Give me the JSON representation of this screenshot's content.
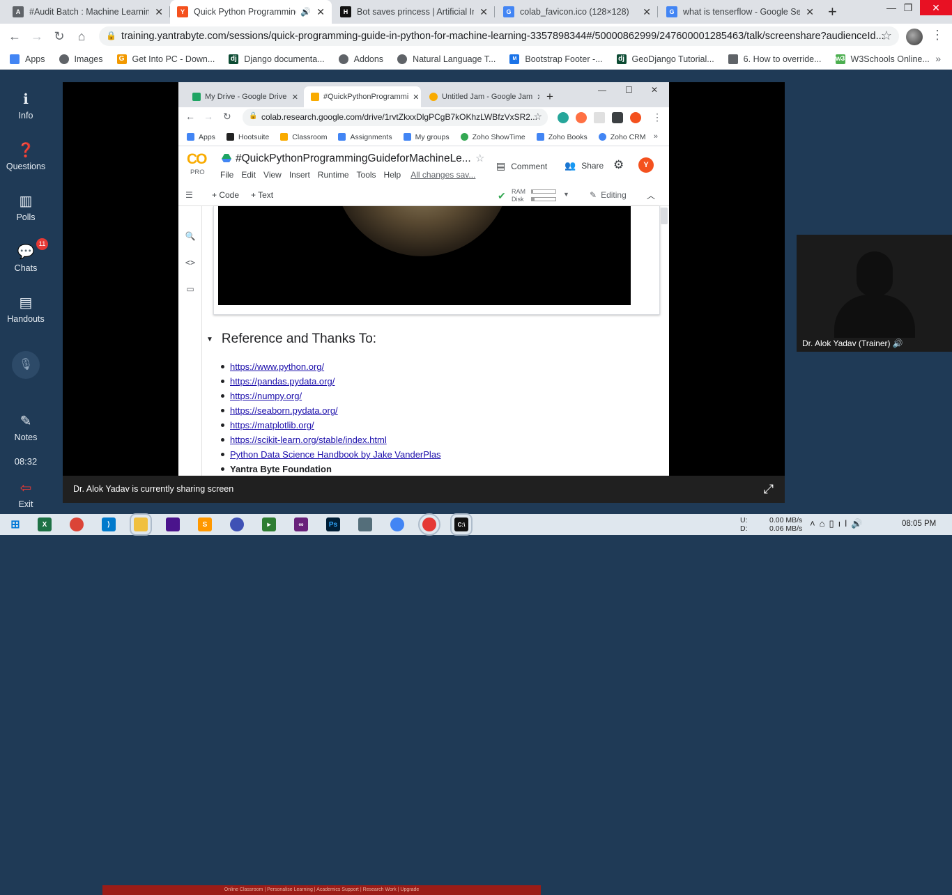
{
  "browser": {
    "tabs": [
      {
        "title": "#Audit Batch : Machine Learning",
        "color": "#5f6368",
        "letter": "A"
      },
      {
        "title": "Quick Python Programming",
        "color": "#f4511e",
        "letter": "Y"
      },
      {
        "title": "Bot saves princess | Artificial Inte",
        "color": "#111",
        "letter": "H"
      },
      {
        "title": "colab_favicon.ico (128×128)",
        "color": "#4285f4",
        "letter": "G"
      },
      {
        "title": "what is tenserflow - Google Sea",
        "color": "#4285f4",
        "letter": "G"
      }
    ],
    "url": "training.yantrabyte.com/sessions/quick-programming-guide-in-python-for-machine-learning-3357898344#/50000862999/247600001285463/talk/screenshare?audienceId...",
    "bookmarks": [
      {
        "label": "Apps",
        "color": "#4285f4"
      },
      {
        "label": "Images",
        "color": "#5f6368"
      },
      {
        "label": "Get Into PC - Down...",
        "color": "#f29900"
      },
      {
        "label": "Django documenta...",
        "color": "#0c4b33"
      },
      {
        "label": "Addons",
        "color": "#5f6368"
      },
      {
        "label": "Natural Language T...",
        "color": "#5f6368"
      },
      {
        "label": "Bootstrap Footer -...",
        "color": "#1a73e8"
      },
      {
        "label": "GeoDjango Tutorial...",
        "color": "#0c4b33"
      },
      {
        "label": "6. How to override...",
        "color": "#5f6368"
      },
      {
        "label": "W3Schools Online...",
        "color": "#4caf50"
      }
    ]
  },
  "sidebar": {
    "items": [
      {
        "label": "Info",
        "icon": "info-icon"
      },
      {
        "label": "Questions",
        "icon": "questions-icon"
      },
      {
        "label": "Polls",
        "icon": "polls-icon"
      },
      {
        "label": "Chats",
        "icon": "chats-icon"
      },
      {
        "label": "Handouts",
        "icon": "handouts-icon"
      },
      {
        "label": "Notes",
        "icon": "notes-icon"
      },
      {
        "label": "Exit",
        "icon": "exit-icon"
      }
    ],
    "chat_badge": "11",
    "time": "08:32"
  },
  "share": {
    "message": "Dr. Alok Yadav is currently sharing screen",
    "presenter": "Dr. Alok Yadav (Trainer)"
  },
  "inner": {
    "tabs": [
      {
        "title": "My Drive - Google Drive",
        "color": "#1fa463"
      },
      {
        "title": "#QuickPythonProgrammi",
        "color": "#f9ab00"
      },
      {
        "title": "Untitled Jam - Google Jam",
        "color": "#f9ab00"
      }
    ],
    "url": "colab.research.google.com/drive/1rvtZkxxDlgPCgB7kOKhzLWBfzVxSR2...",
    "bookmarks": [
      {
        "label": "Apps",
        "color": "#4285f4"
      },
      {
        "label": "Hootsuite",
        "color": "#222"
      },
      {
        "label": "Classroom",
        "color": "#f9ab00"
      },
      {
        "label": "Assignments",
        "color": "#4285f4"
      },
      {
        "label": "My groups",
        "color": "#4285f4"
      },
      {
        "label": "Zoho ShowTime",
        "color": "#34a853"
      },
      {
        "label": "Zoho Books",
        "color": "#4285f4"
      },
      {
        "label": "Zoho CRM",
        "color": "#4285f4"
      }
    ]
  },
  "colab": {
    "logo": "CO",
    "pro": "PRO",
    "title": "#QuickPythonProgrammingGuideforMachineLe...",
    "menu": [
      "File",
      "Edit",
      "View",
      "Insert",
      "Runtime",
      "Tools",
      "Help"
    ],
    "saved": "All changes sav...",
    "comment": "Comment",
    "share": "Share",
    "add_code": "+ Code",
    "add_text": "+ Text",
    "ram": "RAM",
    "disk": "Disk",
    "ram_fraction": 0.05,
    "disk_fraction": 0.12,
    "editing": "Editing",
    "section_title": "Reference and Thanks To:",
    "references": [
      {
        "text": "https://www.python.org/",
        "link": true
      },
      {
        "text": "https://pandas.pydata.org/",
        "link": true
      },
      {
        "text": "https://numpy.org/",
        "link": true
      },
      {
        "text": "https://seaborn.pydata.org/",
        "link": true
      },
      {
        "text": "https://matplotlib.org/",
        "link": true
      },
      {
        "text": "https://scikit-learn.org/stable/index.html",
        "link": true
      },
      {
        "text": "Python Data Science Handbook by Jake VanderPlas",
        "link": true
      },
      {
        "text": "Yantra Byte Foundation",
        "link": false
      }
    ],
    "footer_strip": "Online Classroom | Personalise Learning | Academics Support | Research Work | Upgrade"
  },
  "taskbar": {
    "net_labels": "U:\nD:",
    "up": "0.00 MB/s",
    "down": "0.06 MB/s",
    "clock": "08:05 PM"
  }
}
